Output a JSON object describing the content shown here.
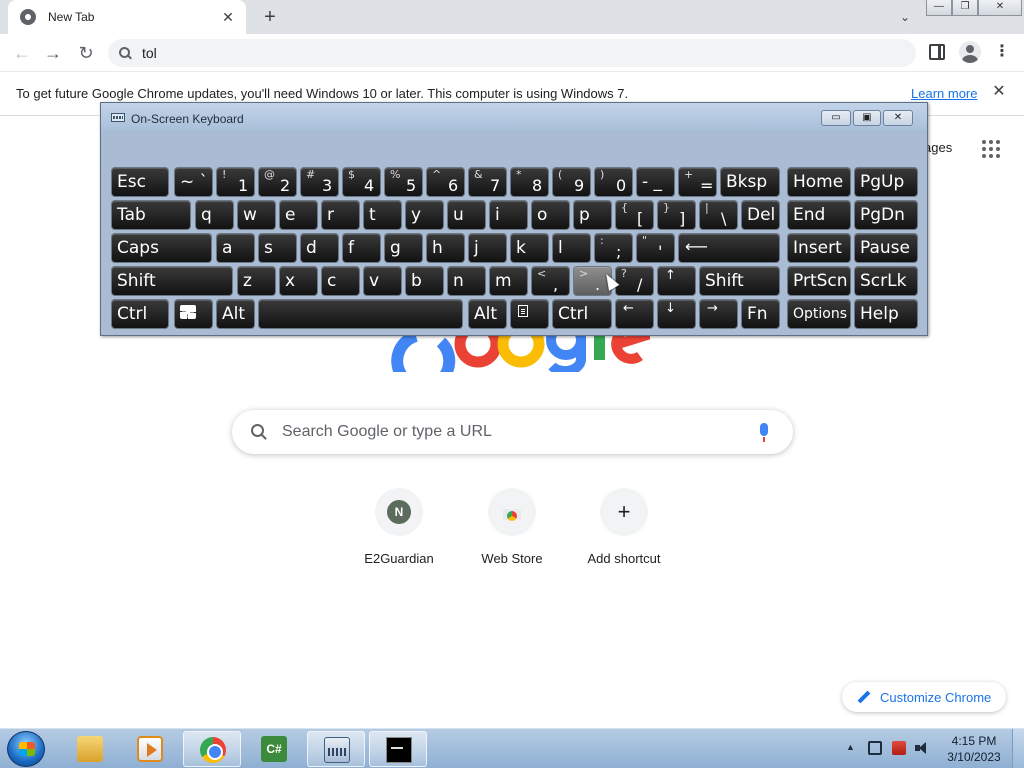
{
  "browser": {
    "tab": {
      "title": "New Tab",
      "close": "✕"
    },
    "new_tab": "+",
    "tab_search": "⌄",
    "window_controls": {
      "minimize": "—",
      "maximize": "❐",
      "close": "✕"
    },
    "nav": {
      "back": "←",
      "forward": "→",
      "reload": "↻"
    },
    "omnibox": {
      "value": "tol"
    },
    "menu": "⋮"
  },
  "infobar": {
    "message": "To get future Google Chrome updates, you'll need Windows 10 or later. This computer is using Windows 7.",
    "link": "Learn more",
    "close": "✕"
  },
  "ntp": {
    "images_link": "ages",
    "search": {
      "placeholder": "Search Google or type a URL"
    },
    "shortcuts": [
      {
        "label": "E2Guardian",
        "initial": "N"
      },
      {
        "label": "Web Store"
      },
      {
        "label": "Add shortcut",
        "glyph": "+"
      }
    ],
    "customize": "Customize Chrome"
  },
  "osk": {
    "title": "On-Screen Keyboard",
    "controls": {
      "minimize": "▭",
      "maximize": "▣",
      "close": "✕"
    },
    "rows": [
      [
        {
          "main": "Esc"
        },
        {
          "main": "~ `"
        },
        {
          "sm": "!",
          "big": "1"
        },
        {
          "sm": "@",
          "big": "2"
        },
        {
          "sm": "#",
          "big": "3"
        },
        {
          "sm": "$",
          "big": "4"
        },
        {
          "sm": "%",
          "big": "5"
        },
        {
          "sm": "^",
          "big": "6"
        },
        {
          "sm": "&",
          "big": "7"
        },
        {
          "sm": "*",
          "big": "8"
        },
        {
          "sm": "(",
          "big": "9"
        },
        {
          "sm": ")",
          "big": "0"
        },
        {
          "main": "- _"
        },
        {
          "sm": "+",
          "big": "="
        },
        {
          "main": "Bksp"
        },
        {
          "main": "Home"
        },
        {
          "main": "PgUp"
        }
      ],
      [
        {
          "main": "Tab"
        },
        {
          "main": "q"
        },
        {
          "main": "w"
        },
        {
          "main": "e"
        },
        {
          "main": "r"
        },
        {
          "main": "t"
        },
        {
          "main": "y"
        },
        {
          "main": "u"
        },
        {
          "main": "i"
        },
        {
          "main": "o"
        },
        {
          "main": "p"
        },
        {
          "sm": "{",
          "big": "["
        },
        {
          "sm": "}",
          "big": "]"
        },
        {
          "sm": "|",
          "big": "\\"
        },
        {
          "main": "Del"
        },
        {
          "main": "End"
        },
        {
          "main": "PgDn"
        }
      ],
      [
        {
          "main": "Caps"
        },
        {
          "main": "a"
        },
        {
          "main": "s"
        },
        {
          "main": "d"
        },
        {
          "main": "f"
        },
        {
          "main": "g"
        },
        {
          "main": "h"
        },
        {
          "main": "j"
        },
        {
          "main": "k"
        },
        {
          "main": "l"
        },
        {
          "sm": ":",
          "big": ";"
        },
        {
          "sm": "\"",
          "big": "'"
        },
        {
          "main": "⟵"
        },
        {
          "main": "Insert"
        },
        {
          "main": "Pause"
        }
      ],
      [
        {
          "main": "Shift"
        },
        {
          "main": "z"
        },
        {
          "main": "x"
        },
        {
          "main": "c"
        },
        {
          "main": "v"
        },
        {
          "main": "b"
        },
        {
          "main": "n"
        },
        {
          "main": "m"
        },
        {
          "sm": "<",
          "big": ","
        },
        {
          "sm": ">",
          "big": "."
        },
        {
          "sm": "?",
          "big": "/"
        },
        {
          "main": "↑"
        },
        {
          "main": "Shift"
        },
        {
          "main": "PrtScn"
        },
        {
          "main": "ScrLk"
        }
      ],
      [
        {
          "main": "Ctrl"
        },
        {
          "main": ""
        },
        {
          "main": "Alt"
        },
        {
          "main": ""
        },
        {
          "main": "Alt"
        },
        {
          "main": ""
        },
        {
          "main": "Ctrl"
        },
        {
          "main": "←"
        },
        {
          "main": "↓"
        },
        {
          "main": "→"
        },
        {
          "main": "Fn"
        },
        {
          "main": "Options"
        },
        {
          "main": "Help"
        }
      ]
    ]
  },
  "taskbar": {
    "apps": [
      "Windows Explorer",
      "Windows Media Player",
      "Google Chrome",
      "C# IDE",
      "On-Screen Keyboard",
      "Command Prompt"
    ],
    "csharp_glyph": "C#",
    "tray_up": "▲",
    "time": "4:15 PM",
    "date": "3/10/2023"
  },
  "colors": {
    "accent": "#1a73e8",
    "tabstrip": "#dee1e6",
    "osk_frame": "#a6bcd6",
    "key_face": "#1a1a1a",
    "taskbar": "#a3bfdc"
  }
}
